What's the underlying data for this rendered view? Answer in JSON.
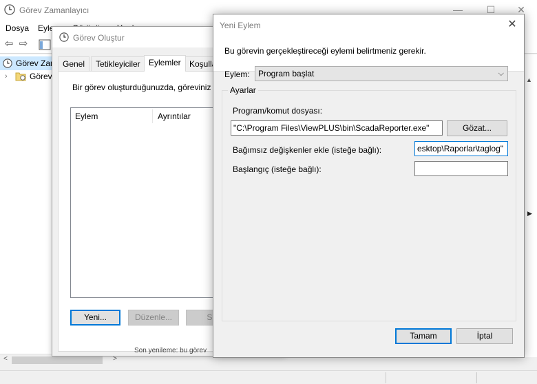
{
  "main": {
    "title": "Görev Zamanlayıcı",
    "minimize": "—",
    "maximize": "☐",
    "close": "✕",
    "menu": [
      "Dosya",
      "Eylem",
      "Görünüm",
      "Yardım"
    ],
    "tree": [
      {
        "label": "Görev Zamanlayıcı (Yerel)"
      },
      {
        "label": "Görev Zamanlayıcı Kitaplığı"
      }
    ],
    "scroll_left": "<",
    "scroll_right": ">",
    "right_arrow": "▶"
  },
  "create_task": {
    "title": "Görev Oluştur",
    "tabs": [
      "Genel",
      "Tetikleyiciler",
      "Eylemler",
      "Koşullar"
    ],
    "active_tab": "Eylemler",
    "intro": "Bir görev oluşturduğunuzda, göreviniz başladığında gerçekleşecek eylemi belirtmeniz gerekir.",
    "columns": [
      "Eylem",
      "Ayrıntılar"
    ],
    "buttons": {
      "new": "Yeni...",
      "edit": "Düzenle...",
      "delete": "Sil"
    },
    "peek_text": "Son yenileme: bu görev"
  },
  "new_action": {
    "title": "Yeni Eylem",
    "close": "✕",
    "description": "Bu görevin gerçekleştireceği eylemi belirtmeniz gerekir.",
    "action_label": "Eylem:",
    "action_value": "Program başlat",
    "settings_legend": "Ayarlar",
    "program_label": "Program/komut dosyası:",
    "program_value": "\"C:\\Program Files\\ViewPLUS\\bin\\ScadaReporter.exe\"",
    "browse_label": "Gözat...",
    "args_label": "Bağımsız değişkenler ekle (isteğe bağlı):",
    "args_value": "esktop\\Raporlar\\taglog\"",
    "start_label": "Başlangıç (isteğe bağlı):",
    "start_value": "",
    "ok_label": "Tamam",
    "cancel_label": "İptal"
  }
}
